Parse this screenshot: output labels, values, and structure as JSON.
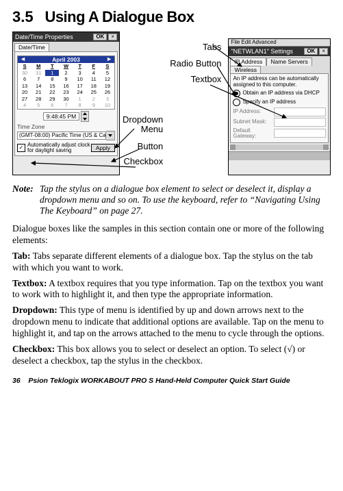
{
  "heading": {
    "num": "3.5",
    "title": "Using A Dialogue Box"
  },
  "annotations": {
    "dropdown_menu": "Dropdown\nMenu",
    "button": "Button",
    "checkbox": "Checkbox",
    "tabs": "Tabs",
    "radio_button": "Radio Button",
    "textbox": "Textbox"
  },
  "win1": {
    "title": "Date/Time Properties",
    "ok": "OK",
    "close": "×",
    "tab": "Date/Time",
    "month_nav_left": "◄",
    "month": "April 2003",
    "month_nav_right": "►",
    "dow": [
      "S",
      "M",
      "T",
      "W",
      "T",
      "F",
      "S"
    ],
    "rows": [
      [
        "30",
        "31",
        "1",
        "2",
        "3",
        "4",
        "5"
      ],
      [
        "6",
        "7",
        "8",
        "9",
        "10",
        "11",
        "12"
      ],
      [
        "13",
        "14",
        "15",
        "16",
        "17",
        "18",
        "19"
      ],
      [
        "20",
        "21",
        "22",
        "23",
        "24",
        "25",
        "26"
      ],
      [
        "27",
        "28",
        "29",
        "30",
        "1",
        "2",
        "3"
      ],
      [
        "4",
        "5",
        "6",
        "7",
        "8",
        "9",
        "10"
      ]
    ],
    "time": "9:48:45 PM",
    "tz_label": "Time Zone",
    "tz_value": "(GMT-08:00) Pacific Time (US & Ca",
    "cb_checked": "✓",
    "cb_label": "Automatically adjust clock for daylight saving",
    "apply": "Apply"
  },
  "win2": {
    "menubar": "File   Edit   Advanced",
    "title": "\"NETWLAN1\" Settings",
    "ok": "OK",
    "close": "×",
    "tabs": [
      "IP Address",
      "Name Servers",
      "Wireless"
    ],
    "sub": "An IP address can be automatically assigned to this computer.",
    "r1": "Obtain an IP address via DHCP",
    "r2": "Specify an IP address",
    "f1": "IP Address:",
    "f2": "Subnet Mask:",
    "f3": "Default Gateway:"
  },
  "note": {
    "label": "Note:",
    "text": "Tap the stylus on a dialogue box element to select or deselect it, display a dropdown menu and so on. To use the keyboard, refer to “Navigating Using The Keyboard” on page 27."
  },
  "intro": "Dialogue boxes like the samples in this section contain one or more of the following elements:",
  "p_tab_term": "Tab:",
  "p_tab": " Tabs separate different elements of a dialogue box. Tap the stylus on the tab with which you want to work.",
  "p_text_term": "Textbox:",
  "p_text": " A textbox requires that you type information. Tap on the textbox you want to work with to highlight it, and then type the appropriate information.",
  "p_drop_term": "Dropdown:",
  "p_drop": " This type of menu is identified by up and down arrows next to the dropdown menu to indicate that additional options are available. Tap on the menu to highlight it, and tap on the arrows attached to the menu to cycle through the options.",
  "p_cb_term": "Checkbox:",
  "p_cb": " This box allows you to select or deselect an option. To select (√) or deselect a checkbox, tap the stylus in the checkbox.",
  "footer": {
    "page": "36",
    "text": "Psion Teklogix WORKABOUT PRO  S Hand-Held Computer Quick Start Guide"
  }
}
